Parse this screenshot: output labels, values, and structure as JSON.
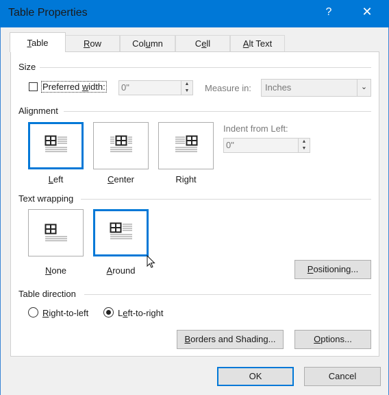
{
  "window": {
    "title": "Table Properties",
    "help_glyph": "?",
    "close_glyph": "✕"
  },
  "tabs": [
    {
      "label": "Table",
      "mnemonic": "T",
      "rest": "able",
      "active": true
    },
    {
      "label": "Row",
      "mnemonic": "R",
      "rest": "ow",
      "active": false
    },
    {
      "label": "Column",
      "mnemonic": "U",
      "pre": "Col",
      "mn": "u",
      "post": "mn",
      "active": false
    },
    {
      "label": "Cell",
      "pre": "C",
      "mn": "e",
      "post": "ll",
      "active": false
    },
    {
      "label": "Alt Text",
      "pre": "",
      "mn": "A",
      "post": "lt Text",
      "active": false
    }
  ],
  "size": {
    "heading": "Size",
    "preferred_width_label": "Preferred width:",
    "preferred_width_mn": "w",
    "preferred_width_checked": false,
    "width_value": "0\"",
    "measure_label": "Measure in:",
    "measure_value": "Inches"
  },
  "alignment": {
    "heading": "Alignment",
    "options": [
      {
        "label": "Left",
        "mn": "L",
        "rest": "eft",
        "selected": true
      },
      {
        "label": "Center",
        "mn": "C",
        "rest": "enter",
        "selected": false
      },
      {
        "label": "Right",
        "pre": "Ri",
        "mn": "g",
        "post": "ht",
        "selected": false
      }
    ],
    "indent_label": "Indent from Left:",
    "indent_value": "0\""
  },
  "text_wrapping": {
    "heading": "Text wrapping",
    "options": [
      {
        "label": "None",
        "mn": "N",
        "rest": "one",
        "selected": false
      },
      {
        "label": "Around",
        "mn": "A",
        "rest": "round",
        "selected": true
      }
    ],
    "positioning_button": "Positioning...",
    "positioning_mn": "P"
  },
  "table_direction": {
    "heading": "Table direction",
    "options": [
      {
        "label": "Right-to-left",
        "mn": "R",
        "rest": "ight-to-left",
        "selected": false
      },
      {
        "label": "Left-to-right",
        "pre": "L",
        "mn": "e",
        "post": "ft-to-right",
        "selected": true
      }
    ]
  },
  "buttons": {
    "borders": {
      "pre": "",
      "mn": "B",
      "post": "orders and Shading...",
      "label": "Borders and Shading..."
    },
    "options": {
      "pre": "",
      "mn": "O",
      "post": "ptions...",
      "label": "Options..."
    },
    "ok": "OK",
    "cancel": "Cancel"
  },
  "colors": {
    "accent": "#0078d7",
    "dialog_bg": "#f0f0f0",
    "button_bg": "#e1e1e1"
  }
}
